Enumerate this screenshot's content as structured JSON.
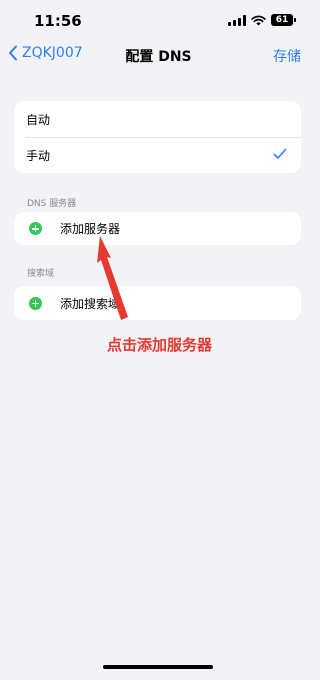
{
  "status_bar": {
    "time": "11:56",
    "battery": "61"
  },
  "nav": {
    "back_label": "ZQKJ007",
    "title": "配置 DNS",
    "save_label": "存储"
  },
  "mode_options": [
    {
      "label": "自动"
    },
    {
      "label": "手动"
    }
  ],
  "dns_section": {
    "header": "DNS 服务器",
    "add_label": "添加服务器"
  },
  "search_section": {
    "header": "搜索域",
    "add_label": "添加搜索域"
  },
  "annotation": {
    "text": "点击添加服务器",
    "color": "#e53a2f"
  },
  "colors": {
    "accent": "#2f7ef6",
    "add_icon": "#34c759",
    "background": "#f2f2f7"
  }
}
